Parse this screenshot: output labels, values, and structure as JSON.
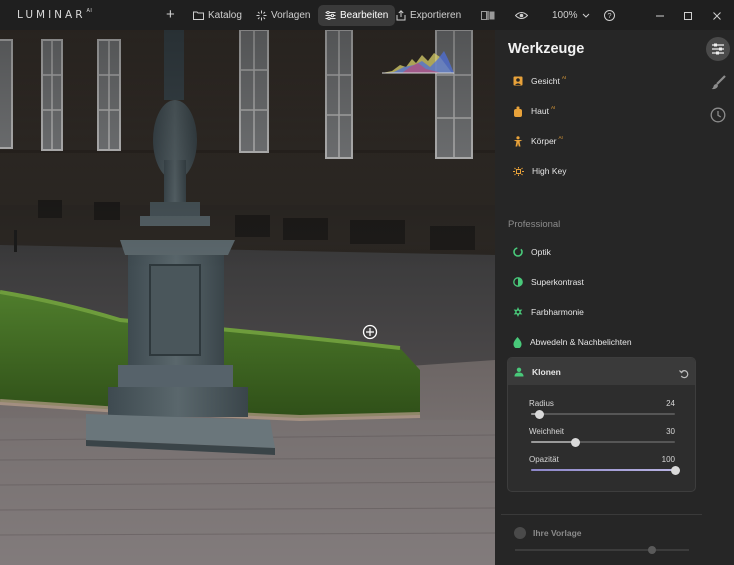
{
  "app": {
    "logo_text": "LUMINAR",
    "logo_suffix": "AI"
  },
  "toolbar": {
    "add_label": "+",
    "katalog_label": "Katalog",
    "vorlagen_label": "Vorlagen",
    "bearbeiten_label": "Bearbeiten",
    "exportieren_label": "Exportieren",
    "zoom_value": "100%",
    "help_label": "?"
  },
  "panel": {
    "title": "Werkzeuge",
    "ai_badge": "AI",
    "tools_ai": [
      {
        "label": "Gesicht",
        "ai": true,
        "icon": "face-icon",
        "color": "#e8a23a"
      },
      {
        "label": "Haut",
        "ai": true,
        "icon": "skin-icon",
        "color": "#e8a23a"
      },
      {
        "label": "Körper",
        "ai": true,
        "icon": "body-icon",
        "color": "#e8a23a"
      },
      {
        "label": "High Key",
        "ai": false,
        "icon": "high-key-icon",
        "color": "#e8a23a"
      }
    ],
    "section_professional": "Professional",
    "tools_professional": [
      {
        "label": "Optik",
        "icon": "optik-icon",
        "color": "#49c97a"
      },
      {
        "label": "Superkontrast",
        "icon": "superkontrast-icon",
        "color": "#49c97a"
      },
      {
        "label": "Farbharmonie",
        "icon": "farbharmonie-icon",
        "color": "#49c97a"
      },
      {
        "label": "Abwedeln & Nachbelichten",
        "icon": "abwedeln-icon",
        "color": "#49c97a"
      }
    ],
    "klonen": {
      "label": "Klonen",
      "icon": "klonen-icon",
      "sliders": [
        {
          "label": "Radius",
          "value": "24",
          "fraction": 0.06
        },
        {
          "label": "Weichheit",
          "value": "30",
          "fraction": 0.31
        },
        {
          "label": "Opazität",
          "value": "100",
          "fraction": 1.0
        }
      ]
    },
    "vorlage_label": "Ihre Vorlage"
  },
  "colors": {
    "accent_green": "#49c97a",
    "accent_orange": "#e8a23a",
    "slider_purple": "#a7a1da"
  }
}
